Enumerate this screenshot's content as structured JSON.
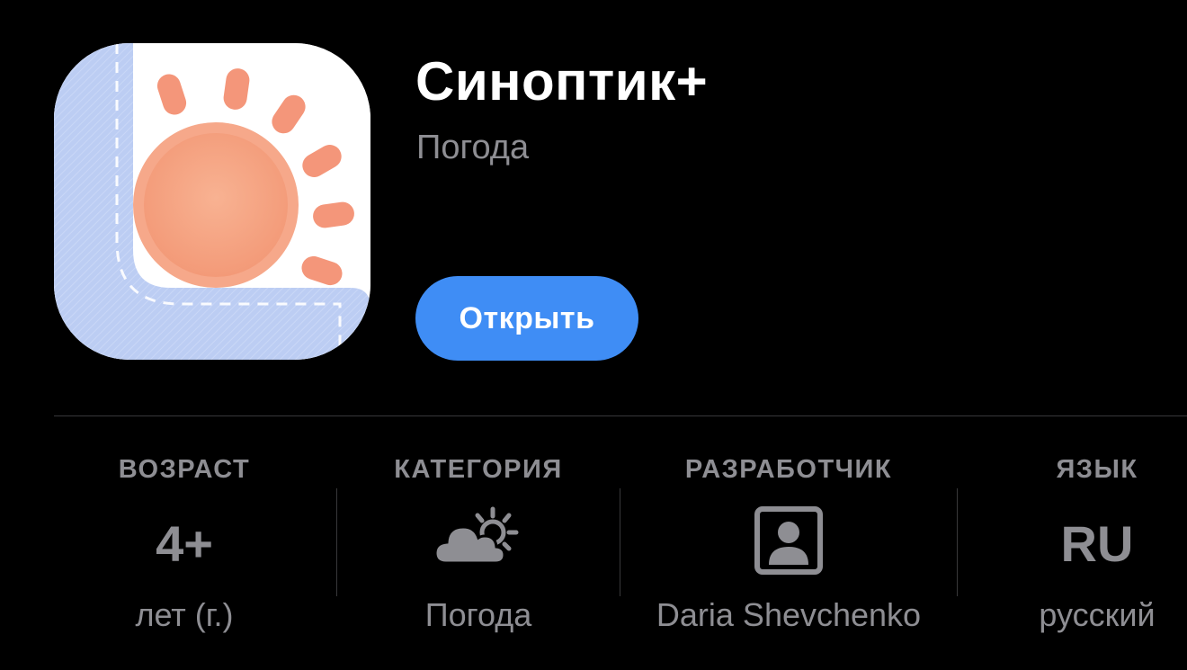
{
  "app": {
    "name": "Синоптик+",
    "category": "Погода",
    "open_button_label": "Открыть",
    "icon_name": "sun-weather-app-icon"
  },
  "info": {
    "age": {
      "label": "ВОЗРАСТ",
      "value": "4+",
      "sub": "лет (г.)"
    },
    "category": {
      "label": "КАТЕГОРИЯ",
      "icon": "cloud-sun-icon",
      "sub": "Погода"
    },
    "developer": {
      "label": "РАЗРАБОТЧИК",
      "icon": "person-portrait-icon",
      "sub": "Daria Shevchenko"
    },
    "language": {
      "label": "ЯЗЫК",
      "value": "RU",
      "sub": "русский"
    }
  },
  "colors": {
    "background": "#000000",
    "accent": "#3f8df5",
    "secondary_text": "#8e8e93",
    "sun": "#f4a07e"
  }
}
